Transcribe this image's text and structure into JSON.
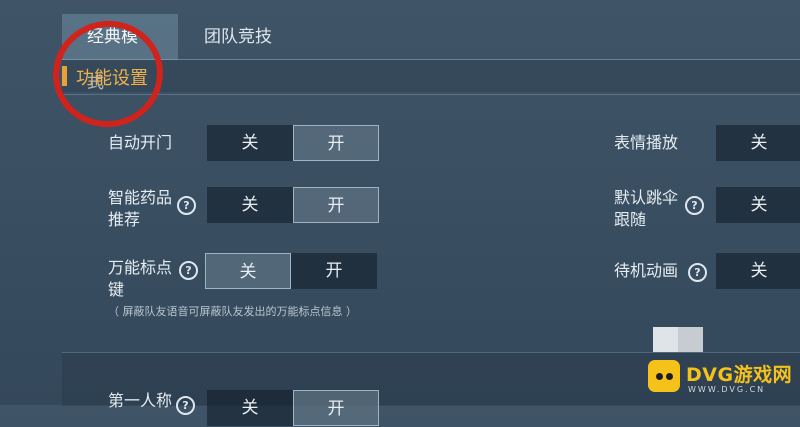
{
  "tabs": [
    {
      "label": "经典模式",
      "active": true
    },
    {
      "label": "团队竞技",
      "active": false
    }
  ],
  "section": {
    "title": "功能设置"
  },
  "toggles": {
    "off_label": "关",
    "on_label": "开",
    "auto_door": {
      "label": "自动开门",
      "state": "开"
    },
    "smart_med": {
      "label_line1": "智能药品",
      "label_line2": "推荐",
      "state": "开"
    },
    "universal_mark": {
      "label_line1": "万能标点",
      "label_line2": "键",
      "state": "关"
    },
    "emote_play": {
      "label": "表情播放"
    },
    "follow_jump": {
      "label_line1": "默认跳伞",
      "label_line2": "跟随"
    },
    "idle_anim": {
      "label": "待机动画"
    },
    "first_person": {
      "label": "第一人称"
    }
  },
  "note": "（ 屏蔽队友语音可屏蔽队友发出的万能标点信息 ）",
  "help_glyph": "?",
  "watermark": {
    "brand": "DVG游戏网",
    "url": "WWW.DVG.CN"
  },
  "colors": {
    "accent": "#f0b04a",
    "annotation": "#d0231b",
    "brand": "#f5c21a"
  }
}
